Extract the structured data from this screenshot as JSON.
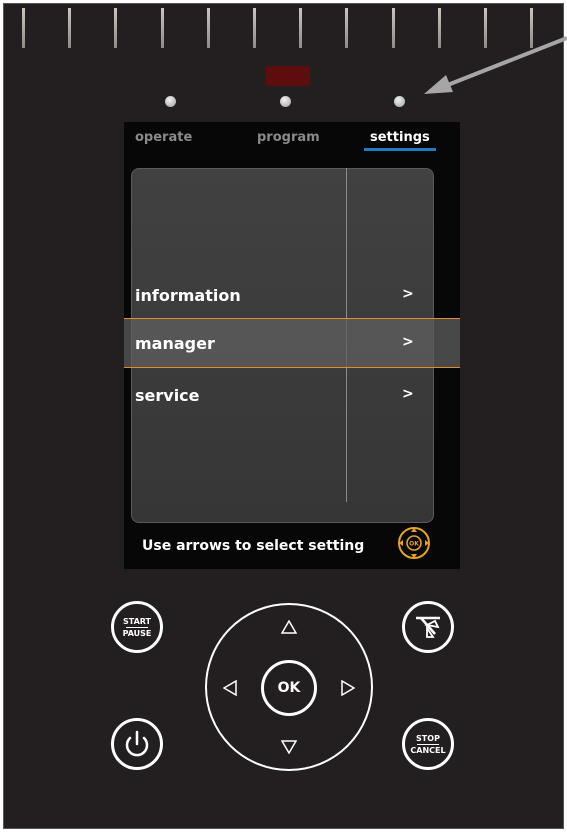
{
  "tabs": {
    "operate": "operate",
    "program": "program",
    "settings": "settings",
    "active": "settings"
  },
  "menu": {
    "items": [
      {
        "label": "information",
        "chevron": ">"
      },
      {
        "label": "manager",
        "chevron": ">",
        "selected": true
      },
      {
        "label": "service",
        "chevron": ">"
      }
    ]
  },
  "hint": {
    "text": "Use arrows to select setting",
    "icon": "ok-arrows-icon"
  },
  "buttons": {
    "start_pause": {
      "top": "START",
      "bottom": "PAUSE"
    },
    "stop_cancel": {
      "top": "STOP",
      "bottom": "CANCEL"
    },
    "ok": "OK",
    "power": "power-icon",
    "fan": "fan-icon"
  },
  "colors": {
    "panel": "#231f20",
    "screen": "#070707",
    "highlight": "#e8892a",
    "tab_accent": "#1e7bc4",
    "ok_icon": "#e8a21f"
  }
}
